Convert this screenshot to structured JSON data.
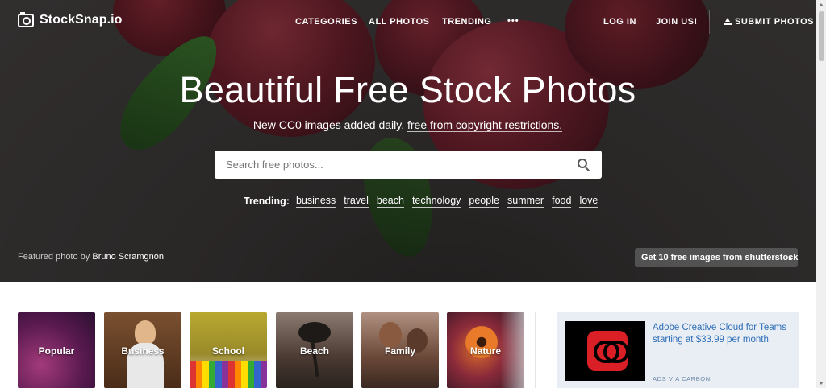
{
  "nav": {
    "logo_text": "StockSnap.io",
    "logo_icon": "camera-icon",
    "categories": "CATEGORIES",
    "all_photos": "ALL PHOTOS",
    "trending": "TRENDING",
    "more": "•••",
    "log_in": "LOG IN",
    "join_us": "JOIN US!",
    "submit_photos": "SUBMIT PHOTOS",
    "submit_icon": "upload-icon"
  },
  "hero": {
    "title": "Beautiful Free Stock Photos",
    "subtitle_prefix": "New CC0 images added daily, ",
    "subtitle_link": "free from copyright restrictions.",
    "search_placeholder": "Search free photos...",
    "search_icon": "search-icon",
    "trending_label": "Trending:",
    "trending_tags": [
      "business",
      "travel",
      "beach",
      "technology",
      "people",
      "summer",
      "food",
      "love"
    ],
    "featured_label": "Featured photo by",
    "featured_author": "Bruno Scramgnon",
    "shutterstock_button": "Get 10 free images from shutterstock",
    "shutterstock_chevron": "›"
  },
  "categories": [
    {
      "label": "Popular"
    },
    {
      "label": "Business"
    },
    {
      "label": "School"
    },
    {
      "label": "Beach"
    },
    {
      "label": "Family"
    },
    {
      "label": "Nature"
    }
  ],
  "ad": {
    "text": "Adobe Creative Cloud for Teams starting at $33.99 per month.",
    "via": "ADS VIA CARBON",
    "logo_icon": "adobe-creative-cloud-icon",
    "brand_color": "#da1f26",
    "link_color": "#2d6eb8"
  }
}
